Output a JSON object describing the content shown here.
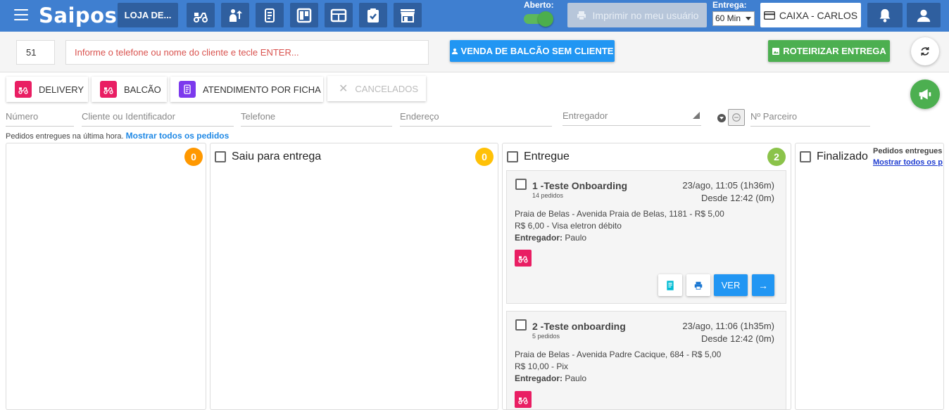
{
  "header": {
    "logo": "Saipos",
    "store_label": "LOJA DE...",
    "aberto_label": "Aberto:",
    "print_user_label": "Imprimir no meu usuário",
    "entrega_label": "Entrega:",
    "entrega_value": "60 Min",
    "caixa_label": "CAIXA - CARLOS",
    "toolbar_icons": [
      "delivery-scooter-icon",
      "waiter-icon",
      "ticket-icon",
      "kanban-icon",
      "table-layout-icon",
      "clipboard-check-icon",
      "store-icon"
    ]
  },
  "search": {
    "number_value": "51",
    "client_placeholder": "Informe o telefone ou nome do cliente e tecle ENTER...",
    "venda_label": "VENDA DE BALCÃO SEM CLIENTE",
    "roteirizar_label": "ROTEIRIZAR ENTREGA"
  },
  "tabs": [
    {
      "label": "DELIVERY"
    },
    {
      "label": "BALCÃO"
    },
    {
      "label": "ATENDIMENTO POR FICHA"
    },
    {
      "label": "CANCELADOS"
    }
  ],
  "filters": {
    "numero": "Número",
    "cliente": "Cliente ou Identificador",
    "telefone": "Telefone",
    "endereco": "Endereço",
    "entregador": "Entregador",
    "parceiro": "Nº Parceiro"
  },
  "info": {
    "text": "Pedidos entregues na última hora.",
    "link": "Mostrar todos os pedidos"
  },
  "columns": {
    "first": {
      "count": "0"
    },
    "saiu": {
      "title": "Saiu para entrega",
      "count": "0"
    },
    "entregue": {
      "title": "Entregue",
      "count": "2"
    },
    "finalizado": {
      "title": "Finalizado",
      "note": "Pedidos entregues",
      "link": "Mostrar todos os p"
    }
  },
  "orders": [
    {
      "title": "1 -Teste Onboarding",
      "sub": "14 pedidos",
      "date": "23/ago, 11:05 (1h36m)",
      "desde": "Desde 12:42 (0m)",
      "address": "Praia de Belas - Avenida Praia de Belas, 1181 - R$ 5,00",
      "payment": "R$ 6,00 - Visa eletron débito",
      "entregador_label": "Entregador:",
      "entregador": "Paulo",
      "ver_label": "VER"
    },
    {
      "title": "2 -Teste onboarding",
      "sub": "5 pedidos",
      "date": "23/ago, 11:06 (1h35m)",
      "desde": "Desde 12:42 (0m)",
      "address": "Praia de Belas - Avenida Padre Cacique, 684 - R$ 5,00",
      "payment": "R$ 10,00 - Pix",
      "entregador_label": "Entregador:",
      "entregador": "Paulo"
    }
  ],
  "colors": {
    "header": "#3f7fd0",
    "primary": "#2196f3",
    "success": "#4caf50",
    "delivery": "#e91e63",
    "ficha": "#7c3aed",
    "badge_orange": "#ff9800",
    "badge_yellow": "#ffc107",
    "badge_green": "#8bc34a"
  }
}
